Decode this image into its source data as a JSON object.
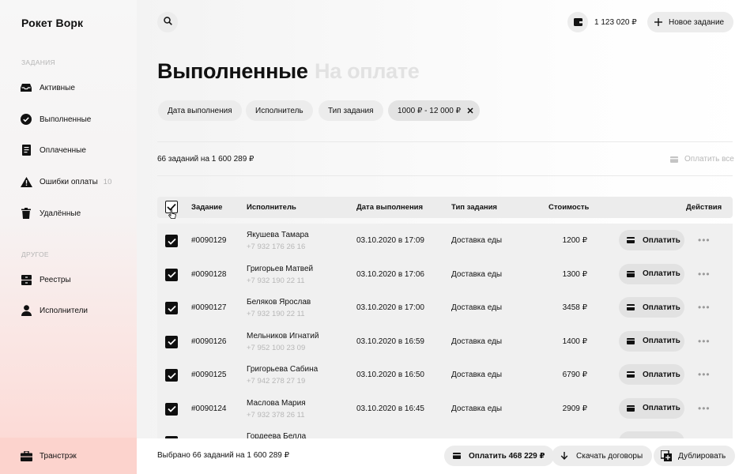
{
  "app": {
    "brand": "Рокет Ворк"
  },
  "sidebar": {
    "section_tasks": "ЗАДАНИЯ",
    "items": [
      {
        "label": "Активные",
        "icon": "inbox-icon"
      },
      {
        "label": "Выполненные",
        "icon": "check-circle-icon"
      },
      {
        "label": "Оплаченные",
        "icon": "receipt-icon"
      },
      {
        "label": "Ошибки оплаты",
        "icon": "warning-icon",
        "count": "10"
      },
      {
        "label": "Удалённые",
        "icon": "trash-icon"
      }
    ],
    "section_other": "ДРУГОЕ",
    "other_items": [
      {
        "label": "Реестры",
        "icon": "registry-icon"
      },
      {
        "label": "Исполнители",
        "icon": "person-icon"
      }
    ],
    "company": {
      "label": "Транстрэк",
      "icon": "briefcase-icon"
    }
  },
  "header": {
    "balance": "1 123 020 ₽",
    "new_task": "Новое задание"
  },
  "tabs": {
    "active": "Выполненные",
    "inactive": "На оплате"
  },
  "filters": {
    "date": "Дата выполнения",
    "executor": "Исполнитель",
    "type": "Тип задания",
    "price_range": "1000 ₽ - 12 000 ₽"
  },
  "summary": "66 заданий на 1 600 289 ₽",
  "pay_all": "Оплатить все",
  "table": {
    "headers": {
      "task": "Задание",
      "executor": "Исполнитель",
      "date": "Дата выполнения",
      "type": "Тип задания",
      "cost": "Стоимость",
      "actions": "Действия"
    },
    "pay_label": "Оплатить",
    "rows": [
      {
        "id": "#0090129",
        "name": "Якушева Тамара",
        "phone": "+7 932 176 26 16",
        "date": "03.10.2020 в 17:09",
        "type": "Доставка еды",
        "cost": "1200 ₽"
      },
      {
        "id": "#0090128",
        "name": "Григорьев Матвей",
        "phone": "+7 932 190 22 11",
        "date": "03.10.2020 в 17:06",
        "type": "Доставка еды",
        "cost": "1300 ₽"
      },
      {
        "id": "#0090127",
        "name": "Беляков Ярослав",
        "phone": "+7 932 190 22 11",
        "date": "03.10.2020 в 17:00",
        "type": "Доставка еды",
        "cost": "3458 ₽"
      },
      {
        "id": "#0090126",
        "name": "Мельников Игнатий",
        "phone": "+7 952 100 23 09",
        "date": "03.10.2020 в 16:59",
        "type": "Доставка еды",
        "cost": "1400 ₽"
      },
      {
        "id": "#0090125",
        "name": "Григорьева Сабина",
        "phone": "+7 942 278 27 19",
        "date": "03.10.2020 в 16:50",
        "type": "Доставка еды",
        "cost": "6790 ₽"
      },
      {
        "id": "#0090124",
        "name": "Маслова Мария",
        "phone": "+7 932 378 26 11",
        "date": "03.10.2020 в 16:45",
        "type": "Доставка еды",
        "cost": "2909 ₽"
      },
      {
        "id": "",
        "name": "Гордеева Белла",
        "phone": "",
        "date": "",
        "type": "",
        "cost": ""
      }
    ]
  },
  "bottom_bar": {
    "selected": "Выбрано 66 заданий на 1 600 289 ₽",
    "pay": "Оплатить 468 229 ₽",
    "download": "Скачать договоры",
    "duplicate": "Дублировать"
  }
}
